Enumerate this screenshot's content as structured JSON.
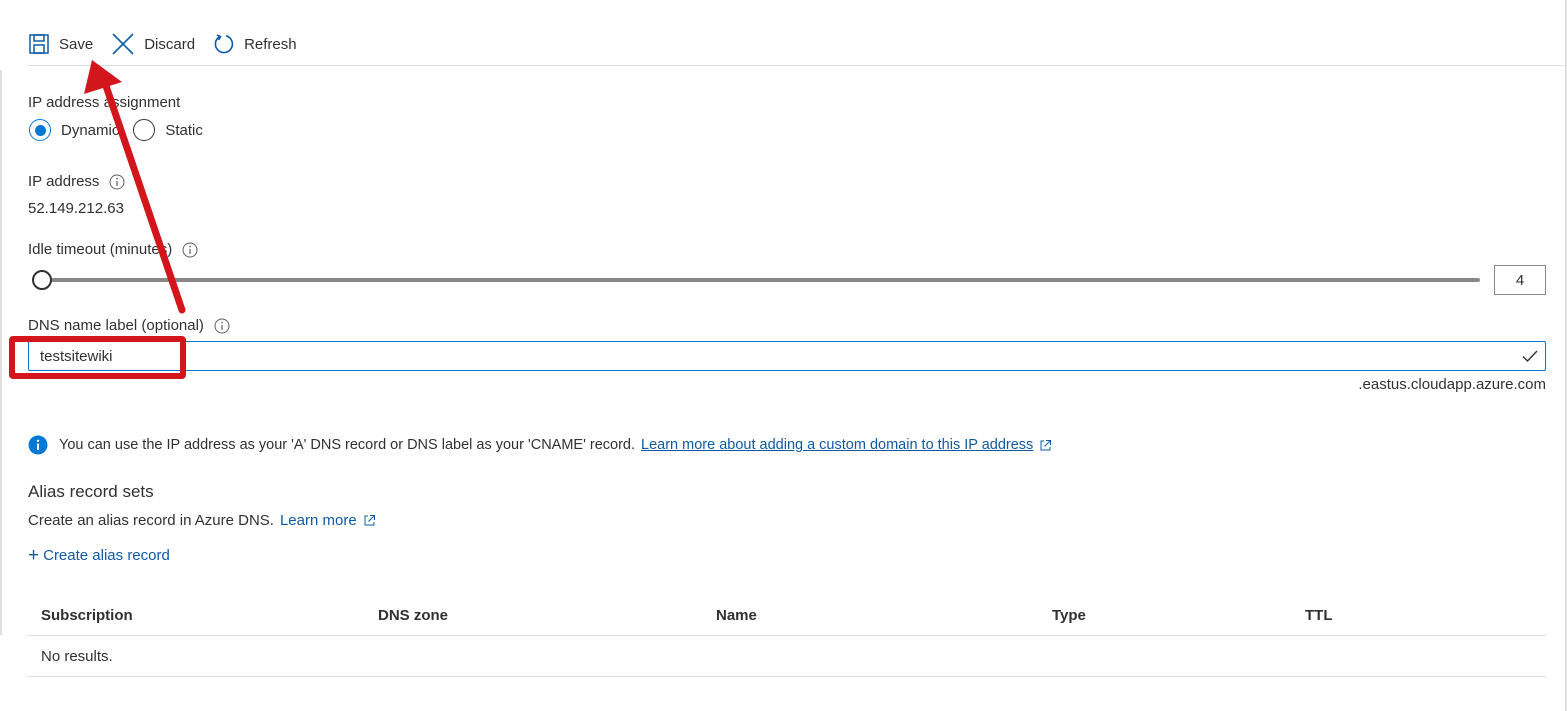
{
  "toolbar": {
    "save_label": "Save",
    "discard_label": "Discard",
    "refresh_label": "Refresh"
  },
  "ip_assignment": {
    "label": "IP address assignment",
    "options": [
      "Dynamic",
      "Static"
    ],
    "selected": "Dynamic"
  },
  "ip_address": {
    "label": "IP address",
    "value": "52.149.212.63"
  },
  "idle_timeout": {
    "label": "Idle timeout (minutes)",
    "value": "4"
  },
  "dns": {
    "label": "DNS name label (optional)",
    "value": "testsitewiki",
    "suffix": ".eastus.cloudapp.azure.com"
  },
  "info": {
    "text": "You can use the IP address as your 'A' DNS record or DNS label as your 'CNAME' record.",
    "link": "Learn more about adding a custom domain to this IP address"
  },
  "alias": {
    "title": "Alias record sets",
    "description": "Create an alias record in Azure DNS.",
    "learn_more": "Learn more",
    "create_label": "Create alias record"
  },
  "table": {
    "columns": [
      "Subscription",
      "DNS zone",
      "Name",
      "Type",
      "TTL"
    ],
    "empty_text": "No results."
  },
  "icons": {
    "save": "save-icon",
    "discard": "close-icon",
    "refresh": "refresh-icon",
    "info": "info-icon",
    "check": "checkmark-icon",
    "external": "external-link-icon"
  },
  "colors": {
    "accent": "#0078d4",
    "link": "#0f5aa6",
    "annotation": "#d3161c",
    "text": "#323130"
  }
}
